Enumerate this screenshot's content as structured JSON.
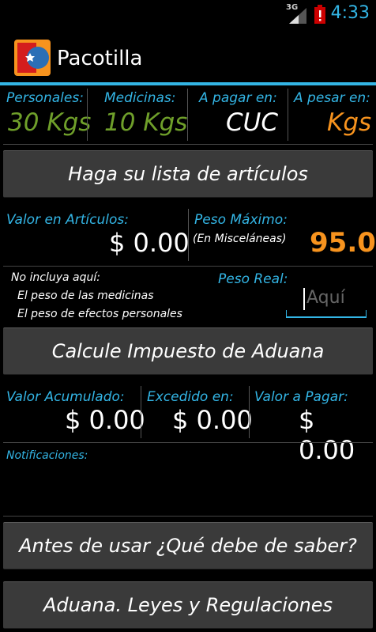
{
  "status": {
    "network": "3G",
    "time": "4:33"
  },
  "app": {
    "title": "Pacotilla"
  },
  "limits": {
    "personales_label": "Personales:",
    "personales_value": "30 Kgs",
    "medicinas_label": "Medicinas:",
    "medicinas_value": "10 Kgs",
    "pagar_label": "A pagar en:",
    "pagar_value": "CUC",
    "pesar_label": "A pesar en:",
    "pesar_value": "Kgs"
  },
  "list_button": "Haga su lista de artículos",
  "articles": {
    "valor_label": "Valor en Artículos:",
    "valor_value": "$ 0.00",
    "peso_max_label": "Peso Máximo:",
    "peso_max_sub": "(En Misceláneas)",
    "peso_max_value": "95.0"
  },
  "notes": {
    "line1": "No incluya aquí:",
    "line2": "El peso de las medicinas",
    "line3": "El peso de efectos personales"
  },
  "peso_real": {
    "label": "Peso Real:",
    "placeholder": "Aquí"
  },
  "calc_button": "Calcule Impuesto de Aduana",
  "totals": {
    "acumulado_label": "Valor Acumulado:",
    "acumulado_value": "$ 0.00",
    "excedido_label": "Excedido en:",
    "excedido_value": "$ 0.00",
    "pagar_label": "Valor a Pagar:",
    "pagar_value": "$ 0.00"
  },
  "notifications_label": "Notificaciones:",
  "info_button": "Antes de usar ¿Qué debe de saber?",
  "laws_button": "Aduana. Leyes y Regulaciones",
  "colors": {
    "accent": "#33b5e5",
    "green": "#6f9f2a",
    "orange": "#f7931e"
  }
}
